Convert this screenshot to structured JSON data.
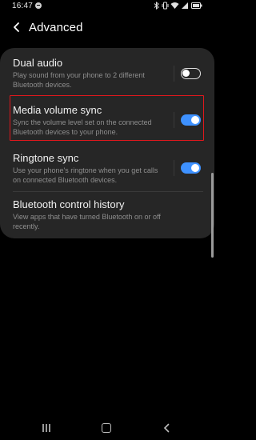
{
  "status_bar": {
    "time": "16:47",
    "notification_icon": "spotify-icon",
    "icons": [
      "bluetooth-icon",
      "vibrate-icon",
      "wifi-icon",
      "signal-icon",
      "battery-icon"
    ]
  },
  "header": {
    "back_icon": "chevron-left-icon",
    "title": "Advanced"
  },
  "settings": [
    {
      "title": "Dual audio",
      "description_lines": [
        "Play sound from your phone to 2 different",
        "Bluetooth devices."
      ],
      "toggle_on": false
    },
    {
      "title": "Media volume sync",
      "description_lines": [
        "Sync the volume level set on the connected",
        "Bluetooth devices to your phone."
      ],
      "toggle_on": true,
      "highlighted": true
    },
    {
      "title": "Ringtone sync",
      "description_lines": [
        "Use your phone's ringtone when you get calls",
        "on connected Bluetooth devices."
      ],
      "toggle_on": true
    },
    {
      "title": "Bluetooth control history",
      "description_lines": [
        "View apps that have turned Bluetooth on or off",
        "recently."
      ]
    }
  ],
  "colors": {
    "accent": "#3e91ff",
    "highlight": "#e0171d",
    "card": "#262626",
    "background": "#000000"
  },
  "nav_bar": {
    "icons": [
      "recents-icon",
      "home-icon",
      "back-icon"
    ]
  }
}
